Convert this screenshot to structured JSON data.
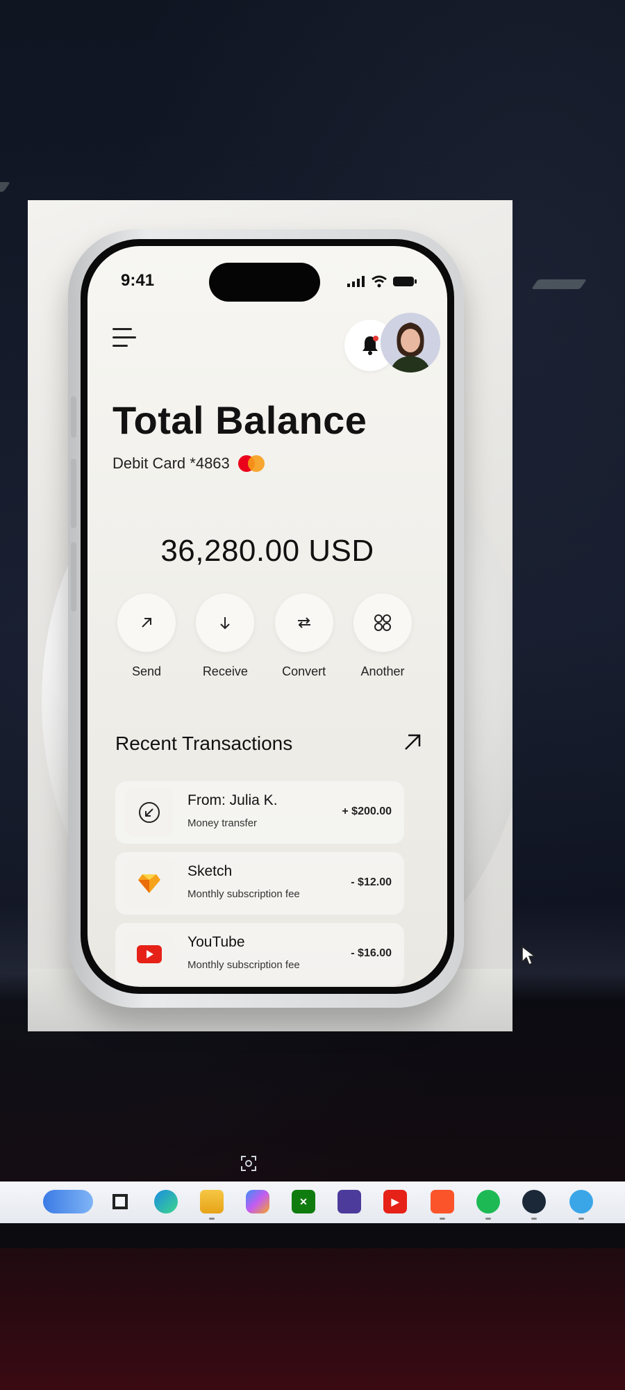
{
  "status_bar": {
    "time": "9:41"
  },
  "header": {
    "menu_icon": "hamburger-icon",
    "notification_icon": "bell-icon",
    "avatar_icon": "profile-avatar"
  },
  "balance_section": {
    "title": "Total Balance",
    "card_label": "Debit Card *4863",
    "card_brand_icon": "mastercard-logo",
    "amount": "36,280.00 USD"
  },
  "actions": [
    {
      "label": "Send",
      "icon": "arrow-up-right-icon"
    },
    {
      "label": "Receive",
      "icon": "arrow-down-icon"
    },
    {
      "label": "Convert",
      "icon": "swap-arrows-icon"
    },
    {
      "label": "Another",
      "icon": "grid-icon"
    }
  ],
  "recent": {
    "title": "Recent Transactions",
    "link_icon": "arrow-up-right-icon",
    "transactions": [
      {
        "title": "From: Julia K.",
        "subtitle": "Money transfer",
        "amount": "+ $200.00",
        "icon": "incoming-arrow-icon"
      },
      {
        "title": "Sketch",
        "subtitle": "Monthly subscription fee",
        "amount": "- $12.00",
        "icon": "sketch-logo"
      },
      {
        "title": "YouTube",
        "subtitle": "Monthly subscription fee",
        "amount": "- $16.00",
        "icon": "youtube-logo"
      }
    ]
  },
  "taskbar": {
    "apps": [
      "search-pill-icon",
      "task-view-icon",
      "edge-icon",
      "file-explorer-icon",
      "copilot-icon",
      "xbox-icon",
      "proton-vpn-icon",
      "youtube-icon",
      "brave-icon",
      "spotify-icon",
      "steam-icon",
      "app-icon"
    ]
  },
  "colors": {
    "accent_red": "#e53935",
    "mastercard_red": "#eb001b",
    "mastercard_orange": "#f79e1b",
    "sketch_orange": "#f7a21b",
    "youtube_red": "#e62117"
  }
}
